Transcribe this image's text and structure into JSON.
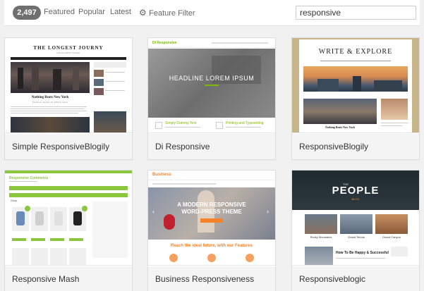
{
  "filter_bar": {
    "count": "2,497",
    "tabs": [
      {
        "label": "Featured"
      },
      {
        "label": "Popular"
      },
      {
        "label": "Latest"
      }
    ],
    "feature_filter_label": "Feature Filter",
    "search_value": "responsive"
  },
  "themes": [
    {
      "name": "Simple ResponsiveBlogily",
      "preview": {
        "title": "THE LONGEST JOURNY",
        "subtitle": "A BLOG ABOUT TRAVEL",
        "post_title": "Nothing Beats New York",
        "post_meta": "Posted on January 22, 2018 by admin"
      }
    },
    {
      "name": "Di Responsive",
      "preview": {
        "logo": "Di Responsive",
        "headline": "HEADLINE LOREM IPSUM",
        "feature_1": "Simply Dummy Text",
        "feature_2": "Printing and Typesetting"
      }
    },
    {
      "name": "ResponsiveBlogily",
      "preview": {
        "title": "WRITE & EXPLORE",
        "post_title": "Nothing Beats New York"
      }
    },
    {
      "name": "Responsive Mash",
      "preview": {
        "logo": "Responsive Commerce",
        "shop_label": "Shop"
      }
    },
    {
      "name": "Business Responsiveness",
      "preview": {
        "logo": "Business",
        "hero_line_1": "A MODERN RESPONSIVE",
        "hero_line_2": "WORD-PRESS THEME",
        "tagline": "Reach the ideal future, with our Features"
      }
    },
    {
      "name": "Responsiveblogic",
      "preview": {
        "title": "PEOPLE",
        "pre_title": "THE",
        "post_title_small": "BLOG",
        "post_1": "Rocky Mountains",
        "post_2": "Grand Tetons",
        "post_3": "Grand Canyon",
        "article": "How To Be Happy & Successful"
      }
    }
  ],
  "colors": {
    "count_badge": "#6f6f6f",
    "mash_green": "#8cc63f",
    "business_orange": "#f5832a",
    "di_green": "#7fb800"
  }
}
